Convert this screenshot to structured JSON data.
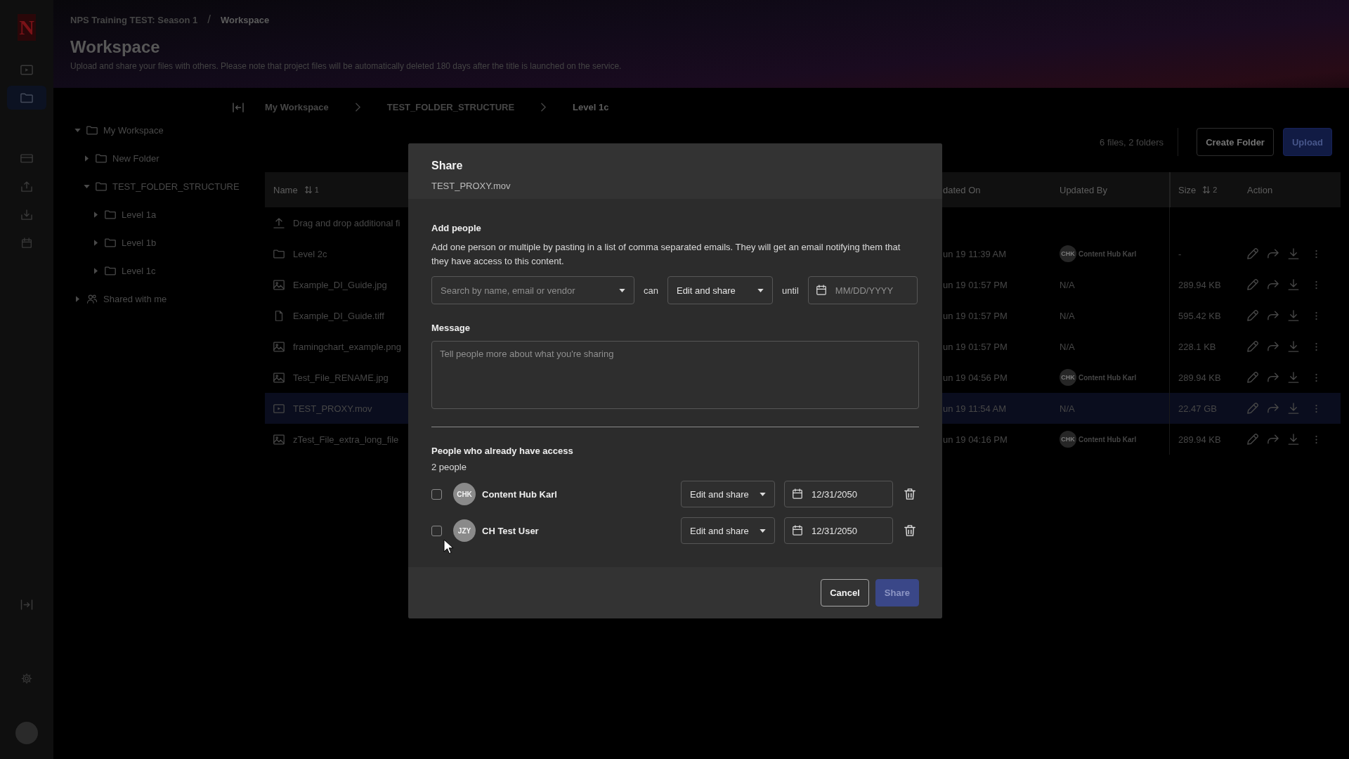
{
  "rail": {
    "logo": "N",
    "nav": [
      {
        "kind": "video",
        "selected": false
      },
      {
        "kind": "folder",
        "selected": true
      }
    ],
    "tools": [
      {
        "kind": "card",
        "selected": false
      },
      {
        "kind": "tray-up",
        "selected": false
      },
      {
        "kind": "tray-down",
        "selected": false
      },
      {
        "kind": "calendar",
        "selected": false
      }
    ]
  },
  "header": {
    "breadcrumb": [
      "NPS Training TEST: Season 1",
      "Workspace"
    ],
    "separator": "/",
    "title": "Workspace",
    "description": "Upload and share your files with others. Please note that project files will be automatically deleted 180 days after the title is launched on the service."
  },
  "tree": [
    {
      "label": "My Workspace",
      "kind": "folder",
      "expanded": true,
      "children": [
        {
          "label": "New Folder",
          "kind": "folder",
          "expanded": false
        },
        {
          "label": "TEST_FOLDER_STRUCTURE",
          "kind": "folder",
          "expanded": true,
          "children": [
            {
              "label": "Level 1a",
              "kind": "folder",
              "expanded": false
            },
            {
              "label": "Level 1b",
              "kind": "folder",
              "expanded": false
            },
            {
              "label": "Level 1c",
              "kind": "folder",
              "expanded": false
            }
          ]
        }
      ]
    },
    {
      "label": "Shared with me",
      "kind": "shared",
      "expanded": false
    }
  ],
  "path": [
    "My Workspace",
    "TEST_FOLDER_STRUCTURE",
    "Level 1c"
  ],
  "toolbar": {
    "count": "6 files, 2 folders",
    "buttons": [
      {
        "label": "Create Folder",
        "kind": "outline"
      },
      {
        "label": "Upload",
        "kind": "primary"
      }
    ]
  },
  "table": {
    "columns": [
      {
        "label": "Name",
        "sort_order": "1"
      },
      {
        "label": "dated On"
      },
      {
        "label": "Updated By"
      },
      {
        "label": "Size",
        "sort_order": "2"
      },
      {
        "label": "Action"
      }
    ],
    "rows": [
      {
        "kind": "upload",
        "name": "Drag and drop additional fi",
        "selected": false
      },
      {
        "kind": "folder",
        "name": "Level 2c",
        "updated_on": "un 19 11:39 AM",
        "updated_by": {
          "initials": "CHK",
          "name": "Content Hub Karl"
        },
        "size": "-",
        "selected": false
      },
      {
        "kind": "image",
        "name": "Example_DI_Guide.jpg",
        "updated_on": "un 19 01:57 PM",
        "updated_by": {
          "name": "N/A"
        },
        "size": "289.94 KB",
        "selected": false
      },
      {
        "kind": "file",
        "name": "Example_DI_Guide.tiff",
        "updated_on": "un 19 01:57 PM",
        "updated_by": {
          "name": "N/A"
        },
        "size": "595.42 KB",
        "selected": false
      },
      {
        "kind": "image",
        "name": "framingchart_example.png",
        "updated_on": "un 19 01:57 PM",
        "updated_by": {
          "name": "N/A"
        },
        "size": "228.1 KB",
        "selected": false
      },
      {
        "kind": "image",
        "name": "Test_File_RENAME.jpg",
        "updated_on": "un 19 04:56 PM",
        "updated_by": {
          "initials": "CHK",
          "name": "Content Hub Karl"
        },
        "size": "289.94 KB",
        "selected": false
      },
      {
        "kind": "video",
        "name": "TEST_PROXY.mov",
        "updated_on": "un 19 11:54 AM",
        "updated_by": {
          "name": "N/A"
        },
        "size": "22.47 GB",
        "selected": true
      },
      {
        "kind": "image",
        "name": "zTest_File_extra_long_file",
        "updated_on": "un 19 04:16 PM",
        "updated_by": {
          "initials": "CHK",
          "name": "Content Hub Karl"
        },
        "size": "289.94 KB",
        "selected": false
      }
    ]
  },
  "dialog": {
    "title": "Share",
    "subtitle": "TEST_PROXY.mov",
    "add_people": {
      "heading": "Add people",
      "text": "Add one person or multiple by pasting in a list of comma separated emails. They will get an email notifying them that they have access to this content.",
      "search": {
        "placeholder": "Search by name, email or vendor"
      },
      "can_label": "can",
      "permission": "Edit and share",
      "until_label": "until",
      "date": {
        "placeholder": "MM/DD/YYYY"
      }
    },
    "message": {
      "label": "Message",
      "placeholder": "Tell people more about what you're sharing"
    },
    "access": {
      "heading": "People who already have access",
      "count": "2 people",
      "people": [
        {
          "initials": "CHK",
          "name": "Content Hub Karl",
          "checked": false,
          "permission": "Edit and share",
          "until": "12/31/2050"
        },
        {
          "initials": "JZY",
          "name": "CH Test User",
          "checked": false,
          "permission": "Edit and share",
          "until": "12/31/2050"
        }
      ]
    },
    "buttons": [
      {
        "label": "Cancel",
        "kind": "secondary",
        "disabled": false
      },
      {
        "label": "Share",
        "kind": "primary",
        "disabled": true
      }
    ]
  }
}
